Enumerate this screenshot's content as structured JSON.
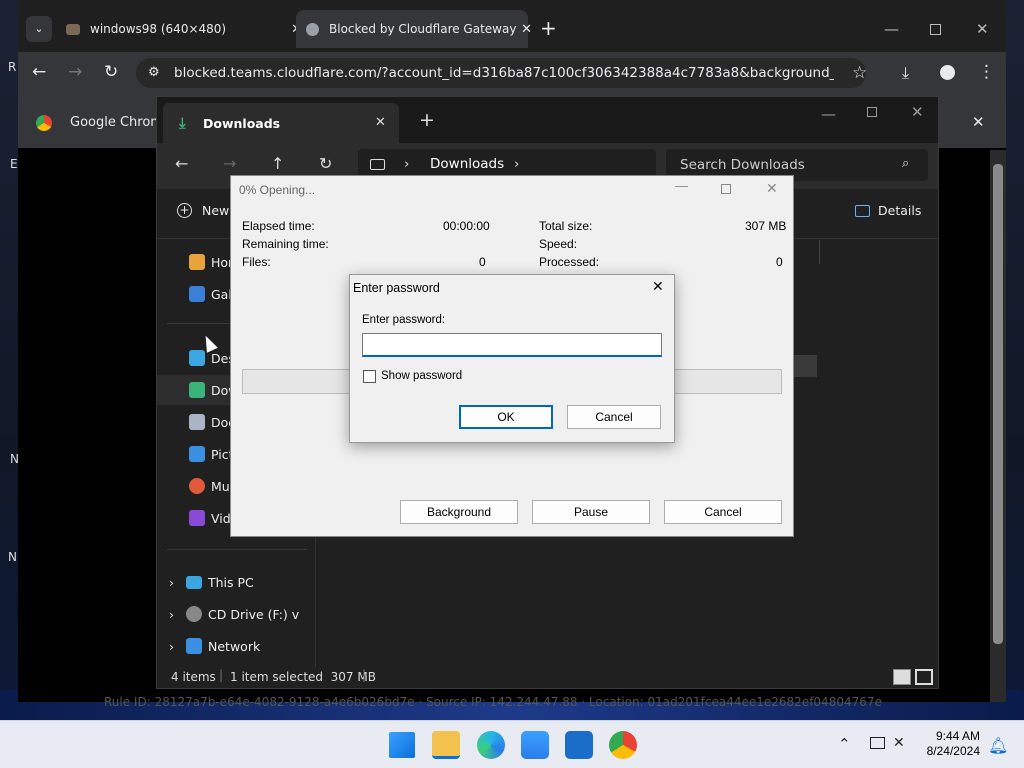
{
  "desktop": {
    "letters": [
      "R",
      "E",
      "N",
      "N"
    ]
  },
  "browser": {
    "tabs": [
      {
        "label": "windows98 (640×480)"
      },
      {
        "label": "Blocked by Cloudflare Gateway"
      }
    ],
    "url": "blocked.teams.cloudflare.com/?account_id=d316ba87c100cf306342388a4c7783a8&background_color=%...",
    "infobar_text": "Google Chrome",
    "rule_text": "Rule ID: 28127a7b-e64e-4082-9128-a4e6b026bd7e · Source IP: 142.244.47.88 · Location: 01ad201fcea44ee1e2682ef04804767e"
  },
  "explorer": {
    "tab_title": "Downloads",
    "breadcrumb": "Downloads",
    "search_placeholder": "Search Downloads",
    "new_label": "New",
    "details_label": "Details",
    "sidebar": [
      {
        "label": "Home",
        "color": "#e8a33a"
      },
      {
        "label": "Gallery",
        "color": "#3a7fd8"
      },
      {
        "label": "Desktop",
        "color": "#3ba6e0"
      },
      {
        "label": "Downloads",
        "color": "#3bb47a"
      },
      {
        "label": "Documents",
        "color": "#aab4c4"
      },
      {
        "label": "Pictures",
        "color": "#3a8fe0"
      },
      {
        "label": "Music",
        "color": "#e05a3a"
      },
      {
        "label": "Videos",
        "color": "#8a4ad8"
      }
    ],
    "tree": [
      {
        "label": "This PC"
      },
      {
        "label": "CD Drive (F:) virt"
      },
      {
        "label": "Network"
      }
    ],
    "status_items": "4 items",
    "status_selected": "1 item selected  307 MB"
  },
  "progress": {
    "title": "0% Opening...",
    "elapsed_label": "Elapsed time:",
    "elapsed_value": "00:00:00",
    "remaining_label": "Remaining time:",
    "files_label": "Files:",
    "files_value": "0",
    "total_label": "Total size:",
    "total_value": "307 MB",
    "speed_label": "Speed:",
    "processed_label": "Processed:",
    "processed_value": "0",
    "background_btn": "Background",
    "pause_btn": "Pause",
    "cancel_btn": "Cancel"
  },
  "password": {
    "title": "Enter password",
    "prompt": "Enter password:",
    "show_label": "Show password",
    "ok": "OK",
    "cancel": "Cancel"
  },
  "taskbar": {
    "time": "9:44 AM",
    "date": "8/24/2024"
  }
}
